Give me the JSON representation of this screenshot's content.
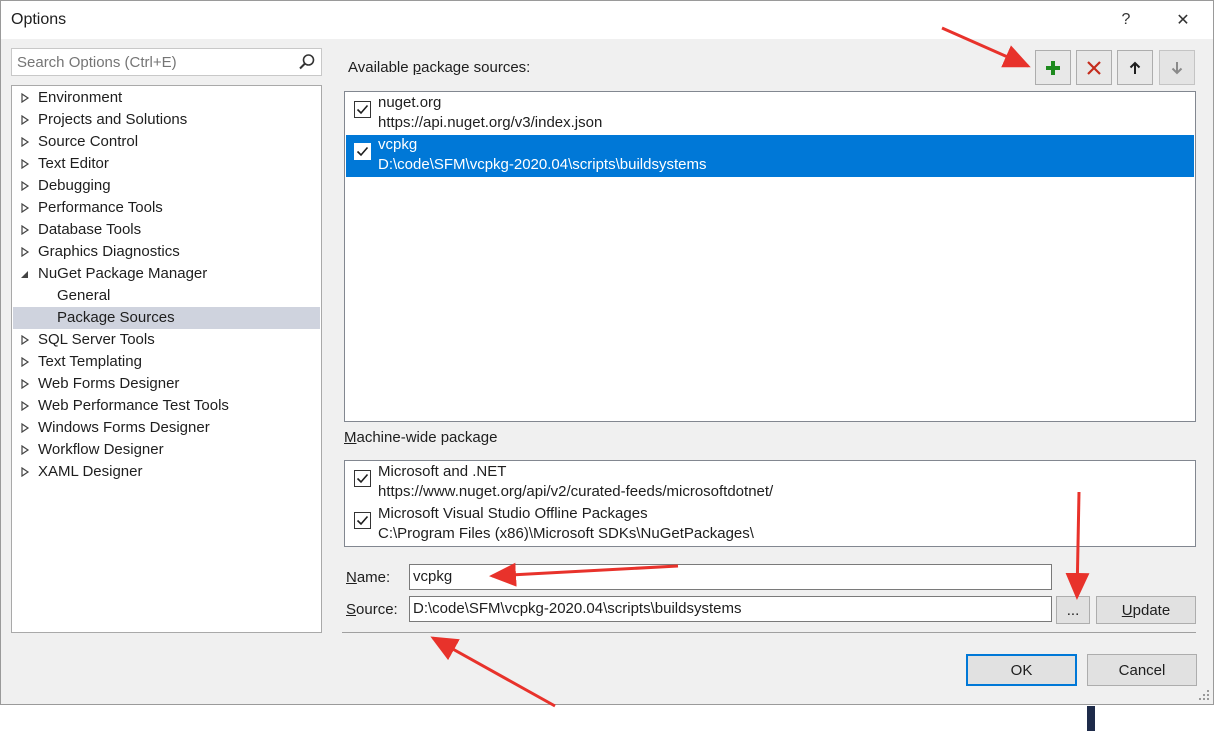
{
  "window": {
    "title": "Options",
    "help_glyph": "?",
    "close_glyph": "✕"
  },
  "search": {
    "placeholder": "Search Options (Ctrl+E)"
  },
  "tree": {
    "items": [
      {
        "label": "Environment",
        "expanded": false
      },
      {
        "label": "Projects and Solutions",
        "expanded": false
      },
      {
        "label": "Source Control",
        "expanded": false
      },
      {
        "label": "Text Editor",
        "expanded": false
      },
      {
        "label": "Debugging",
        "expanded": false
      },
      {
        "label": "Performance Tools",
        "expanded": false
      },
      {
        "label": "Database Tools",
        "expanded": false
      },
      {
        "label": "Graphics Diagnostics",
        "expanded": false
      },
      {
        "label": "NuGet Package Manager",
        "expanded": true
      },
      {
        "label": "General",
        "child": true
      },
      {
        "label": "Package Sources",
        "child": true,
        "selected": true
      },
      {
        "label": "SQL Server Tools",
        "expanded": false
      },
      {
        "label": "Text Templating",
        "expanded": false
      },
      {
        "label": "Web Forms Designer",
        "expanded": false
      },
      {
        "label": "Web Performance Test Tools",
        "expanded": false
      },
      {
        "label": "Windows Forms Designer",
        "expanded": false
      },
      {
        "label": "Workflow Designer",
        "expanded": false
      },
      {
        "label": "XAML Designer",
        "expanded": false
      }
    ]
  },
  "available": {
    "label_before": "Available ",
    "label_accel": "p",
    "label_after": "ackage sources:",
    "sources": [
      {
        "name": "nuget.org",
        "url": "https://api.nuget.org/v3/index.json",
        "checked": true,
        "selected": false
      },
      {
        "name": "vcpkg",
        "url": "D:\\code\\SFM\\vcpkg-2020.04\\scripts\\buildsystems",
        "checked": true,
        "selected": true
      }
    ]
  },
  "toolbar": {
    "add_icon": "plus-icon",
    "remove_icon": "x-icon",
    "up_icon": "arrow-up-icon",
    "down_icon": "arrow-down-icon"
  },
  "machine_wide": {
    "label_accel": "M",
    "label_after": "achine-wide package",
    "sources": [
      {
        "name": "Microsoft and .NET",
        "url": "https://www.nuget.org/api/v2/curated-feeds/microsoftdotnet/",
        "checked": true
      },
      {
        "name": "Microsoft Visual Studio Offline Packages",
        "url": "C:\\Program Files (x86)\\Microsoft SDKs\\NuGetPackages\\",
        "checked": true
      }
    ]
  },
  "form": {
    "name_label_accel": "N",
    "name_label_after": "ame:",
    "name_value": "vcpkg",
    "source_label_accel": "S",
    "source_label_after": "ource:",
    "source_value": "D:\\code\\SFM\\vcpkg-2020.04\\scripts\\buildsystems",
    "browse_label": "...",
    "update_label_accel": "U",
    "update_label_after": "pdate"
  },
  "buttons": {
    "ok": "OK",
    "cancel": "Cancel"
  },
  "colors": {
    "selection": "#0078d7",
    "add_green": "#1e8a1e",
    "remove_red": "#c42b1c",
    "annotation_red": "#e8322b"
  }
}
